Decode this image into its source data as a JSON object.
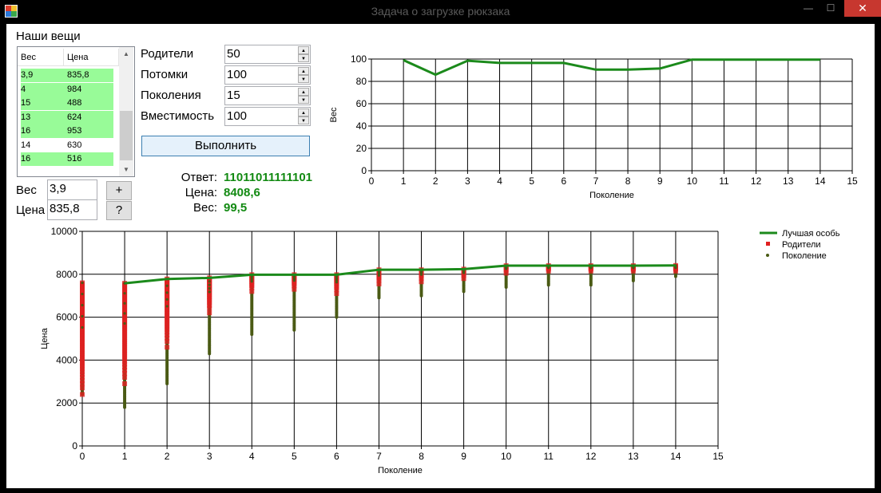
{
  "window": {
    "title": "Задача о загрузке рюкзака",
    "min": "—",
    "max": "☐",
    "close": "✕"
  },
  "items": {
    "label": "Наши вещи",
    "headers": [
      "Вес",
      "Цена"
    ],
    "rows": [
      {
        "weight": "3,9",
        "price": "835,8",
        "selected": true
      },
      {
        "weight": "4",
        "price": "984",
        "selected": true
      },
      {
        "weight": "15",
        "price": "488",
        "selected": true
      },
      {
        "weight": "13",
        "price": "624",
        "selected": true
      },
      {
        "weight": "16",
        "price": "953",
        "selected": true
      },
      {
        "weight": "14",
        "price": "630",
        "selected": false
      },
      {
        "weight": "16",
        "price": "516",
        "selected": true
      }
    ]
  },
  "editor": {
    "weight_label": "Вес",
    "weight_value": "3,9",
    "price_label": "Цена",
    "price_value": "835,8",
    "add_label": "+",
    "help_label": "?"
  },
  "params": [
    {
      "label": "Родители",
      "value": "50"
    },
    {
      "label": "Потомки",
      "value": "100"
    },
    {
      "label": "Поколения",
      "value": "15"
    },
    {
      "label": "Вместимость",
      "value": "100"
    }
  ],
  "run_label": "Выполнить",
  "result": {
    "answer_label": "Ответ:",
    "answer_value": "11011011111101",
    "price_label": "Цена:",
    "price_value": "8408,6",
    "weight_label": "Вес:",
    "weight_value": "99,5"
  },
  "colors": {
    "best": "#1b8a1b",
    "parents": "#e02020",
    "generation": "#4a5a14",
    "selected_row": "#98fb98",
    "result_text": "#128a12"
  },
  "chart_data": [
    {
      "type": "line",
      "xlabel": "Поколение",
      "ylabel": "Вес",
      "xlim": [
        0,
        15
      ],
      "ylim": [
        0,
        100
      ],
      "xticks": [
        0,
        1,
        2,
        3,
        4,
        5,
        6,
        7,
        8,
        9,
        10,
        11,
        12,
        13,
        14,
        15
      ],
      "yticks": [
        0,
        20,
        40,
        60,
        80,
        100
      ],
      "grid": true,
      "series": [
        {
          "x": [
            1,
            2,
            3,
            4,
            5,
            6,
            7,
            8,
            9,
            10,
            11,
            12,
            13,
            14
          ],
          "y": [
            99,
            86,
            98.5,
            96.5,
            96.5,
            96.5,
            90.5,
            90.5,
            91.5,
            99.5,
            99.5,
            99.5,
            99.5,
            99.5
          ]
        }
      ]
    },
    {
      "type": "scatter",
      "xlabel": "Поколение",
      "ylabel": "Цена",
      "xlim": [
        0,
        15
      ],
      "ylim": [
        0,
        10000
      ],
      "xticks": [
        0,
        1,
        2,
        3,
        4,
        5,
        6,
        7,
        8,
        9,
        10,
        11,
        12,
        13,
        14,
        15
      ],
      "yticks": [
        0,
        2000,
        4000,
        6000,
        8000,
        10000
      ],
      "grid": true,
      "legend": "top-right",
      "series": [
        {
          "name": "Лучшая особь",
          "kind": "line",
          "x": [
            1,
            2,
            3,
            4,
            5,
            6,
            7,
            8,
            9,
            10,
            11,
            12,
            13,
            14
          ],
          "y": [
            7580,
            7780,
            7830,
            7980,
            7980,
            7980,
            8210,
            8210,
            8240,
            8400,
            8400,
            8400,
            8400,
            8408.6
          ]
        },
        {
          "name": "Родители",
          "kind": "points",
          "range": [
            {
              "x": 0,
              "min": 2400,
              "max": 7600
            },
            {
              "x": 1,
              "min": 2900,
              "max": 7580
            },
            {
              "x": 2,
              "min": 4600,
              "max": 7780
            },
            {
              "x": 3,
              "min": 6200,
              "max": 7830
            },
            {
              "x": 4,
              "min": 7200,
              "max": 7980
            },
            {
              "x": 5,
              "min": 7300,
              "max": 7980
            },
            {
              "x": 6,
              "min": 7100,
              "max": 7980
            },
            {
              "x": 7,
              "min": 7550,
              "max": 8210
            },
            {
              "x": 8,
              "min": 7650,
              "max": 8210
            },
            {
              "x": 9,
              "min": 7800,
              "max": 8240
            },
            {
              "x": 10,
              "min": 8050,
              "max": 8400
            },
            {
              "x": 11,
              "min": 8150,
              "max": 8400
            },
            {
              "x": 12,
              "min": 8150,
              "max": 8400
            },
            {
              "x": 13,
              "min": 8150,
              "max": 8400
            },
            {
              "x": 14,
              "min": 8150,
              "max": 8408.6
            }
          ]
        },
        {
          "name": "Поколение",
          "kind": "points",
          "range": [
            {
              "x": 0,
              "min": 2400,
              "max": 7600
            },
            {
              "x": 1,
              "min": 1800,
              "max": 7580
            },
            {
              "x": 2,
              "min": 2900,
              "max": 7780
            },
            {
              "x": 3,
              "min": 4300,
              "max": 7830
            },
            {
              "x": 4,
              "min": 5200,
              "max": 7980
            },
            {
              "x": 5,
              "min": 5400,
              "max": 7980
            },
            {
              "x": 6,
              "min": 6000,
              "max": 7980
            },
            {
              "x": 7,
              "min": 6900,
              "max": 8210
            },
            {
              "x": 8,
              "min": 7000,
              "max": 8210
            },
            {
              "x": 9,
              "min": 7200,
              "max": 8240
            },
            {
              "x": 10,
              "min": 7400,
              "max": 8400
            },
            {
              "x": 11,
              "min": 7500,
              "max": 8400
            },
            {
              "x": 12,
              "min": 7500,
              "max": 8400
            },
            {
              "x": 13,
              "min": 7700,
              "max": 8400
            },
            {
              "x": 14,
              "min": 7900,
              "max": 8408.6
            }
          ]
        }
      ]
    }
  ]
}
